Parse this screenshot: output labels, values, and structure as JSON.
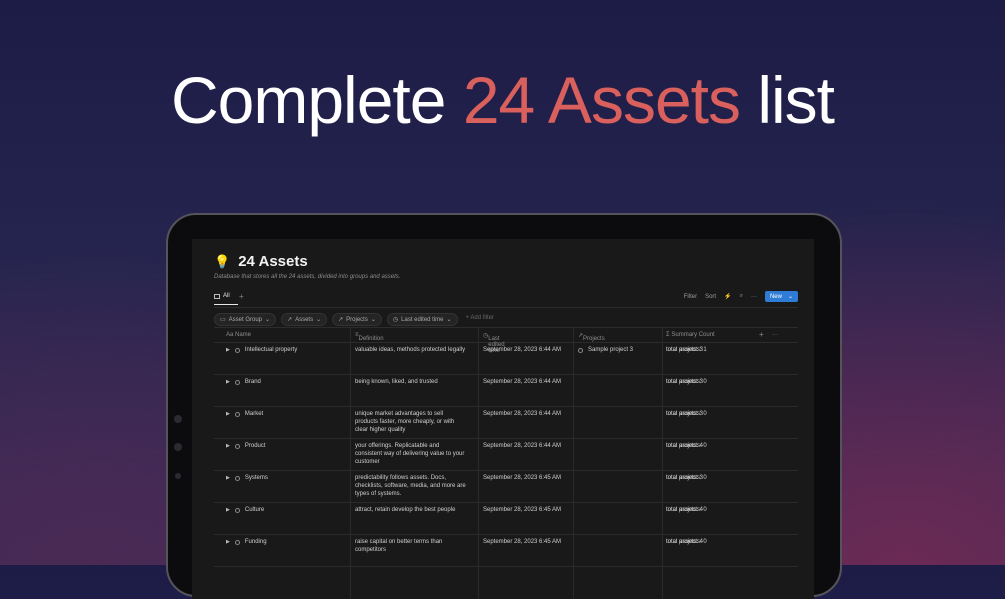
{
  "headline": {
    "part1": "Complete",
    "accent": "24 Assets",
    "part2": "list"
  },
  "accent_color": "#d9605c",
  "db": {
    "icon": "lightbulb-icon",
    "title": "24 Assets",
    "description": "Database that stores all the 24 assets, divided into groups and assets."
  },
  "view": {
    "tab_label": "All",
    "add": "+"
  },
  "toolbar": {
    "filter": "Filter",
    "sort": "Sort",
    "lightning": "⚡",
    "search": "⌕",
    "more": "···",
    "new": "New",
    "new_arrow": "⌄"
  },
  "filters": {
    "chips": [
      "Asset Group",
      "Assets",
      "Projects",
      "Last edited time"
    ],
    "chip_icons": [
      "folder-icon",
      "relation-arrow-icon",
      "relation-arrow-icon",
      "clock-icon"
    ],
    "add_filter": "+ Add filter"
  },
  "columns": {
    "name": "Aa Name",
    "definition": "Definition",
    "last_edited": "Last edited time",
    "projects": "Projects",
    "summary": "Σ Summary Count",
    "add": "+",
    "more": "···"
  },
  "rows": [
    {
      "name": "Intellectual property",
      "definition": [
        "valuable ideas, methods protected legally"
      ],
      "edited": "September 28, 2023 6:44 AM",
      "project": "Sample project 3",
      "sum1": "total projects: 1",
      "sum2": "total assets: 3"
    },
    {
      "name": "Brand",
      "definition": [
        "being known, liked, and trusted"
      ],
      "edited": "September 28, 2023 6:44 AM",
      "project": "",
      "sum1": "total projects: 0",
      "sum2": "total assets: 3"
    },
    {
      "name": "Market",
      "definition": [
        "unique market advantages to sell",
        "products faster, more cheaply, or with",
        "clear higher quality"
      ],
      "edited": "September 28, 2023 6:44 AM",
      "project": "",
      "sum1": "total projects: 0",
      "sum2": "total assets: 3"
    },
    {
      "name": "Product",
      "definition": [
        "your offerings. Replicatable and",
        "consistent way of delivering value to your",
        "customer"
      ],
      "edited": "September 28, 2023 6:44 AM",
      "project": "",
      "sum1": "total projects: 0",
      "sum2": "total assets: 4"
    },
    {
      "name": "Systems",
      "definition": [
        "predictability follows assets. Docs,",
        "checklists, software, media, and more are",
        "types of systems."
      ],
      "edited": "September 28, 2023 6:45 AM",
      "project": "",
      "sum1": "total projects: 0",
      "sum2": "total assets: 3"
    },
    {
      "name": "Culture",
      "definition": [
        "attract, retain develop the best people"
      ],
      "edited": "September 28, 2023 6:45 AM",
      "project": "",
      "sum1": "total projects: 0",
      "sum2": "total assets: 4"
    },
    {
      "name": "Funding",
      "definition": [
        "raise capital on better terms than",
        "competitors"
      ],
      "edited": "September 28, 2023 6:45 AM",
      "project": "",
      "sum1": "total projects: 0",
      "sum2": "total assets: 4"
    }
  ]
}
